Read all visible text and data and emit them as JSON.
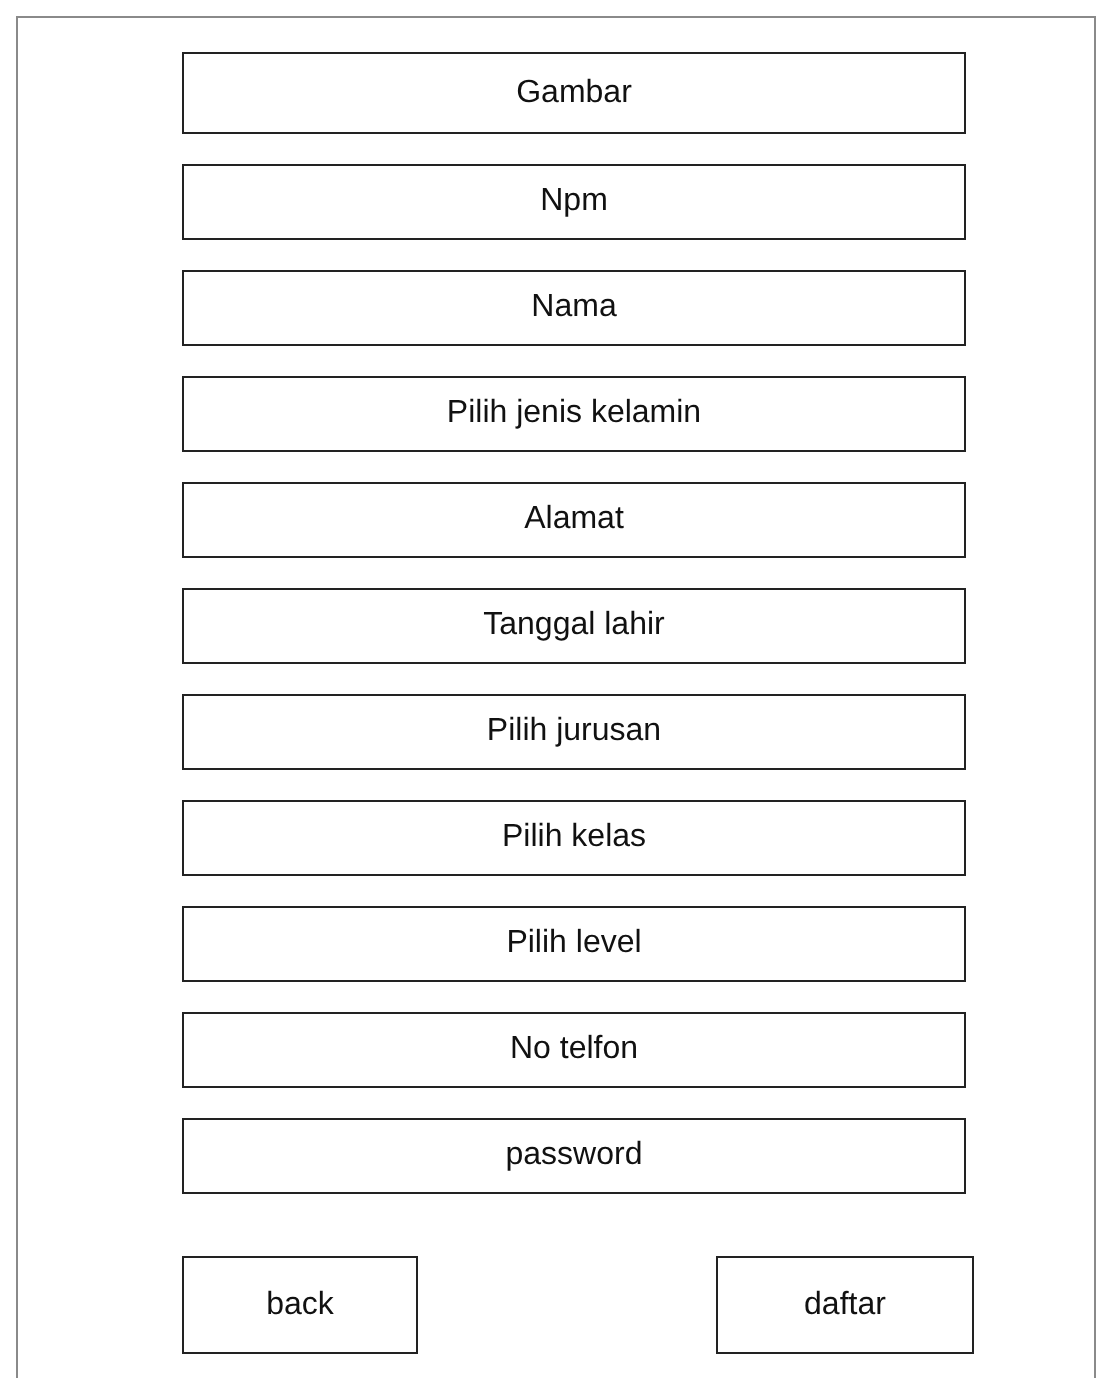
{
  "fields": [
    {
      "label": "Gambar"
    },
    {
      "label": "Npm"
    },
    {
      "label": "Nama"
    },
    {
      "label": "Pilih jenis kelamin"
    },
    {
      "label": "Alamat"
    },
    {
      "label": "Tanggal lahir"
    },
    {
      "label": "Pilih jurusan"
    },
    {
      "label": "Pilih kelas"
    },
    {
      "label": "Pilih level"
    },
    {
      "label": "No telfon"
    },
    {
      "label": "password"
    }
  ],
  "buttons": [
    {
      "label": "back"
    },
    {
      "label": "daftar"
    }
  ]
}
